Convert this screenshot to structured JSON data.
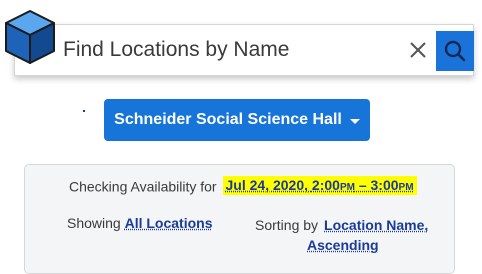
{
  "search": {
    "placeholder": "Find Locations by Name",
    "value": ""
  },
  "building": {
    "selected": "Schneider Social Science Hall"
  },
  "availability": {
    "checking_label": "Checking Availability for",
    "date": "Jul 24, 2020,",
    "time_start_num": "2:00",
    "time_start_suffix": "PM",
    "time_separator": "–",
    "time_end_num": "3:00",
    "time_end_suffix": "PM",
    "showing_label": "Showing",
    "showing_value": "All Locations",
    "sorting_label": "Sorting by",
    "sorting_value_line1": "Location Name,",
    "sorting_value_line2": "Ascending"
  },
  "colors": {
    "primary_button": "#1774d8",
    "search_button": "#1a73d9",
    "link": "#1a3a9a",
    "highlight": "#ffff00",
    "panel_bg": "#f4f5f7",
    "cube_front": "#1e63b8",
    "cube_top": "#5aa6ef",
    "cube_side": "#134a8f"
  },
  "icons": {
    "logo": "cube-logo-icon",
    "clear": "close-icon",
    "search": "search-icon",
    "dropdown": "caret-down-icon"
  }
}
